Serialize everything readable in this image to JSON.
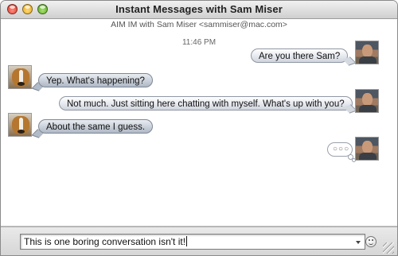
{
  "window": {
    "title": "Instant Messages with Sam Miser",
    "subtitle": "AIM IM with Sam Miser <sammiser@mac.com>"
  },
  "chat": {
    "timestamp": "11:46 PM",
    "messages": [
      {
        "side": "right",
        "text": "Are you there Sam?",
        "avatar": "sam-avatar"
      },
      {
        "side": "left",
        "text": "Yep. What's happening?",
        "avatar": "dog-avatar"
      },
      {
        "side": "right",
        "text": "Not much. Just sitting here chatting with myself. What's up with you?",
        "avatar": "sam-avatar"
      },
      {
        "side": "left",
        "text": "About the same I guess.",
        "avatar": "dog-avatar"
      }
    ],
    "typing_indicator": "○○○"
  },
  "input": {
    "value": "This is one boring conversation isn't it!"
  },
  "icons": {
    "close": "close-icon",
    "minimize": "minimize-icon",
    "zoom": "zoom-icon",
    "smiley": "smiley-icon",
    "resize": "resize-grip-icon"
  },
  "colors": {
    "close": "#d8301f",
    "minimize": "#e3a20f",
    "zoom": "#4ea21a"
  }
}
